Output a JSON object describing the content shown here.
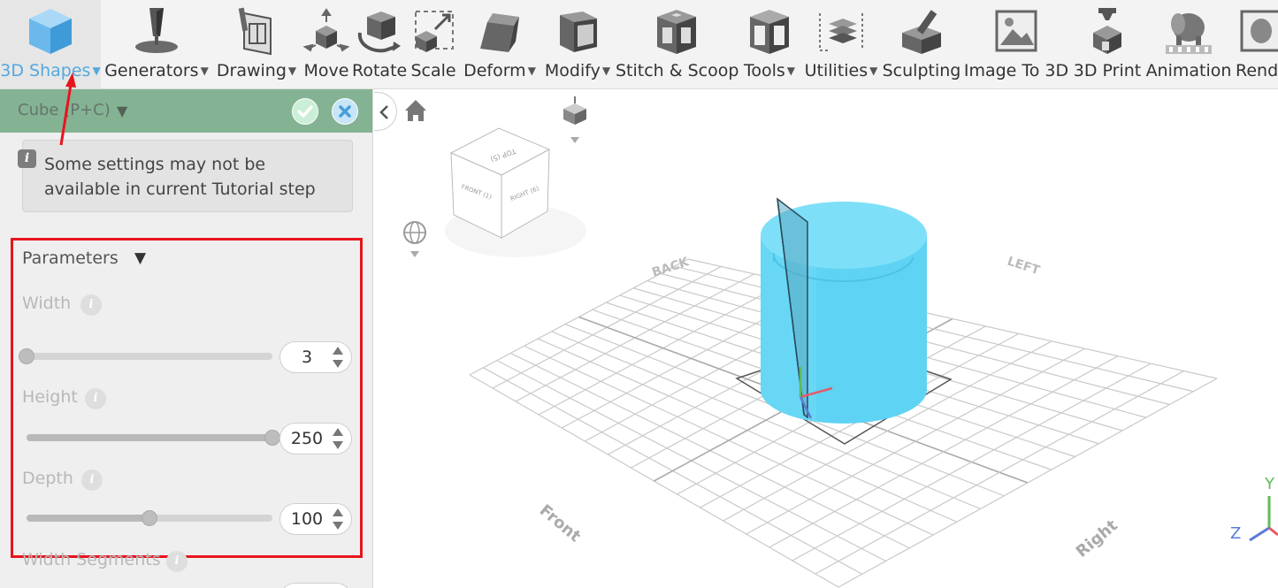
{
  "toolbar": {
    "items": [
      {
        "label": "3D Shapes",
        "icon": "cube-icon",
        "has_menu": true,
        "active": true
      },
      {
        "label": "Generators",
        "icon": "generator-icon",
        "has_menu": true
      },
      {
        "label": "Drawing",
        "icon": "drawing-icon",
        "has_menu": true
      },
      {
        "label": "Move",
        "icon": "move-icon",
        "has_menu": false
      },
      {
        "label": "Rotate",
        "icon": "rotate-icon",
        "has_menu": false
      },
      {
        "label": "Scale",
        "icon": "scale-icon",
        "has_menu": false
      },
      {
        "label": "Deform",
        "icon": "deform-icon",
        "has_menu": true
      },
      {
        "label": "Modify",
        "icon": "modify-icon",
        "has_menu": true
      },
      {
        "label": "Stitch & Scoop",
        "icon": "stitch-scoop-icon",
        "has_menu": false
      },
      {
        "label": "Tools",
        "icon": "tools-icon",
        "has_menu": true
      },
      {
        "label": "Utilities",
        "icon": "utilities-icon",
        "has_menu": true
      },
      {
        "label": "Sculpting",
        "icon": "sculpting-icon",
        "has_menu": false
      },
      {
        "label": "Image To 3D",
        "icon": "image-to-3d-icon",
        "has_menu": false
      },
      {
        "label": "3D Print",
        "icon": "3d-print-icon",
        "has_menu": false
      },
      {
        "label": "Animation",
        "icon": "animation-icon",
        "has_menu": false
      },
      {
        "label": "Rend",
        "icon": "render-icon",
        "has_menu": false
      }
    ]
  },
  "panel": {
    "title": "Cube (P+C)",
    "info_text": "Some settings may not be available in current Tutorial step",
    "parameters_title": "Parameters",
    "params": [
      {
        "label": "Width",
        "value": "3",
        "fraction": 0.0
      },
      {
        "label": "Height",
        "value": "250",
        "fraction": 1.0
      },
      {
        "label": "Depth",
        "value": "100",
        "fraction": 0.5
      }
    ],
    "next_label": "Width Segments"
  },
  "viewport": {
    "cube_labels": {
      "top": "TOP (5)",
      "front": "FRONT (1)",
      "right": "RIGHT (6)"
    },
    "grid_labels": {
      "back": "BACK",
      "left": "LEFT",
      "front": "Front",
      "right": "Right"
    },
    "axes": {
      "y": "Y",
      "z": "Z"
    },
    "colors": {
      "object": "#5fd3f3",
      "grid": "#c9c9c9",
      "accent": "#54a8df",
      "highlight": "#e8141c",
      "panel_header": "#7fb08f"
    }
  }
}
